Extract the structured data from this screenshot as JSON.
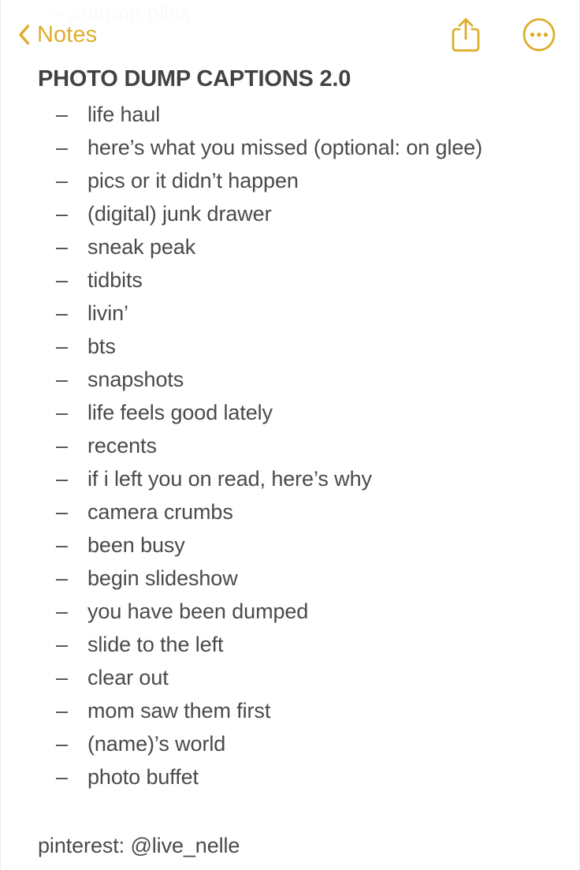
{
  "watermark": {
    "text": "–  autumn bliss"
  },
  "navbar": {
    "back_label": "Notes",
    "back_icon": "chevron-left-icon",
    "share_icon": "share-icon",
    "more_icon": "more-circle-icon",
    "accent_color": "#ddae2c"
  },
  "note": {
    "title": "PHOTO DUMP CAPTIONS 2.0",
    "bullet": "–",
    "text_color": "#4a4a4c",
    "title_color": "#434343",
    "items": [
      "life haul",
      "here’s what you missed (optional: on glee)",
      "pics or it didn’t happen",
      "(digital) junk drawer",
      "sneak peak",
      "tidbits",
      "livin’",
      "bts",
      "snapshots",
      "life feels good lately",
      "recents",
      "if i left you on read, here’s why",
      "camera crumbs",
      "been busy",
      "begin slideshow",
      "you have been dumped",
      "slide to the left",
      "clear out",
      "mom saw them first",
      "(name)’s world",
      "photo buffet"
    ],
    "footer": "pinterest: @live_nelle"
  }
}
